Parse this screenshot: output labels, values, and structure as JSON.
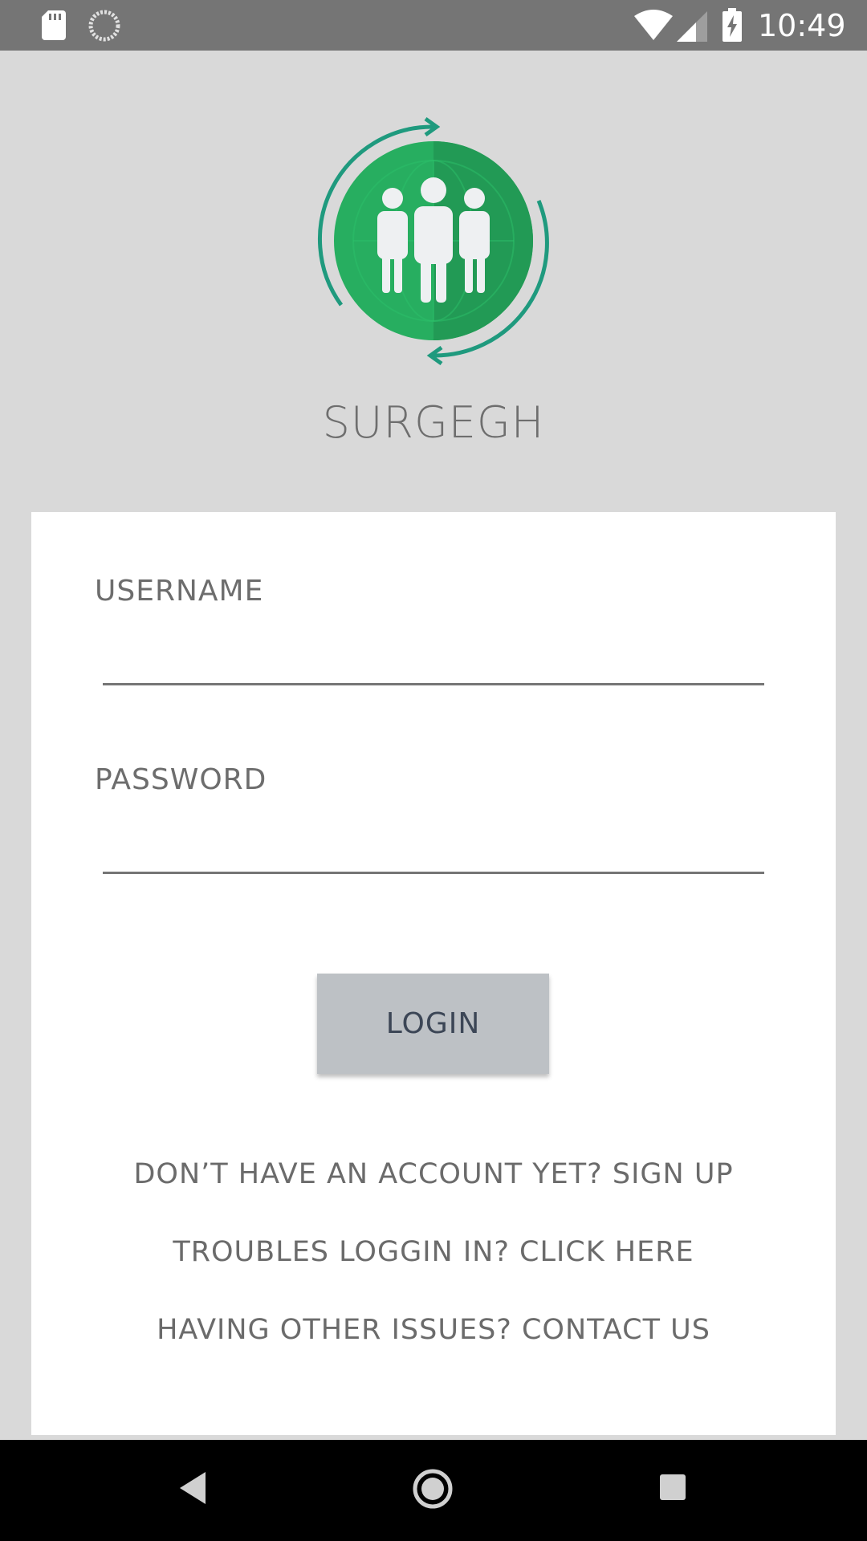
{
  "status_bar": {
    "time": "10:49",
    "icons": [
      "sd-card-icon",
      "sync-icon",
      "wifi-icon",
      "cell-signal-icon",
      "battery-charging-icon"
    ]
  },
  "app": {
    "title": "SURGEGH",
    "logo_icon": "group-globe-logo",
    "accent_color": "#27ae60"
  },
  "login_form": {
    "username_label": "USERNAME",
    "username_value": "",
    "password_label": "PASSWORD",
    "password_value": "",
    "login_label": "LOGIN"
  },
  "links": {
    "signup": "DON’T HAVE AN ACCOUNT YET? SIGN UP",
    "trouble": "TROUBLES LOGGIN IN? CLICK HERE",
    "contact": "HAVING OTHER ISSUES? CONTACT US"
  },
  "nav_bar": {
    "icons": [
      "back-icon",
      "home-icon",
      "recent-apps-icon"
    ]
  }
}
